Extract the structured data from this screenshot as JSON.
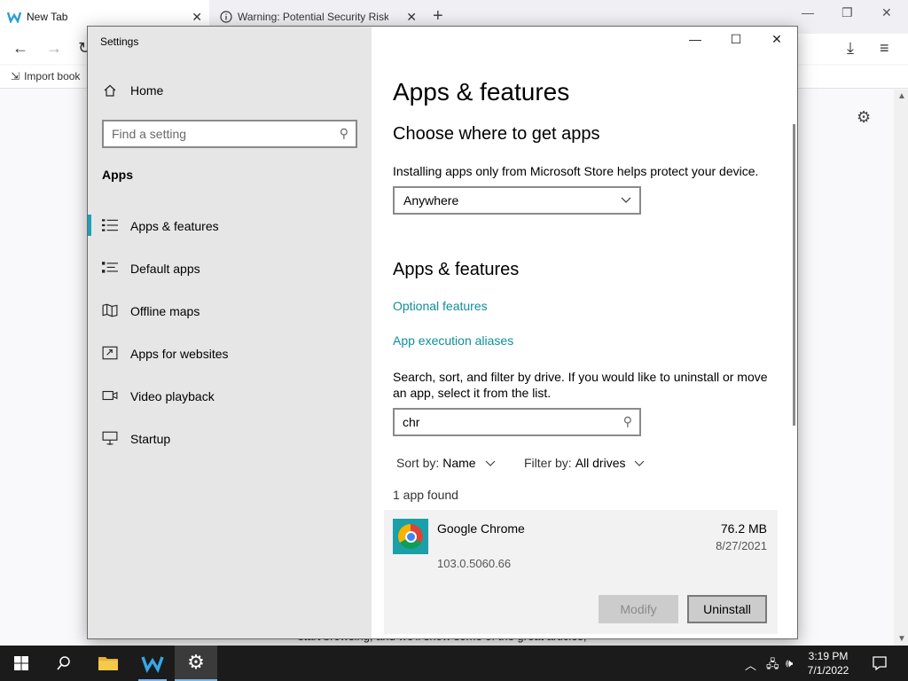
{
  "browser": {
    "tabs": [
      {
        "title": "New Tab",
        "active": true
      },
      {
        "title": "Warning: Potential Security Risk Ah",
        "active": false
      }
    ],
    "bookmark": "Import book",
    "bottom_text": "start browsing, and we'll show some of the great articles,"
  },
  "settings": {
    "window_title": "Settings",
    "home_label": "Home",
    "search": {
      "placeholder": "Find a setting"
    },
    "section_label": "Apps",
    "nav": [
      {
        "label": "Apps & features",
        "icon": "list-icon",
        "active": true
      },
      {
        "label": "Default apps",
        "icon": "default-apps-icon",
        "active": false
      },
      {
        "label": "Offline maps",
        "icon": "map-icon",
        "active": false
      },
      {
        "label": "Apps for websites",
        "icon": "link-window-icon",
        "active": false
      },
      {
        "label": "Video playback",
        "icon": "video-icon",
        "active": false
      },
      {
        "label": "Startup",
        "icon": "startup-icon",
        "active": false
      }
    ],
    "main": {
      "title": "Apps & features",
      "choose_heading": "Choose where to get apps",
      "choose_desc": "Installing apps only from Microsoft Store helps protect your device.",
      "source_value": "Anywhere",
      "features_heading": "Apps & features",
      "optional_features": "Optional features",
      "execution_aliases": "App execution aliases",
      "search_desc": "Search, sort, and filter by drive. If you would like to uninstall or move an app, select it from the list.",
      "search_value": "chr",
      "sort_label": "Sort by:",
      "sort_value": "Name",
      "filter_label": "Filter by:",
      "filter_value": "All drives",
      "count_text": "1 app found",
      "app": {
        "name": "Google Chrome",
        "size": "76.2 MB",
        "date": "8/27/2021",
        "version": "103.0.5060.66"
      },
      "modify_label": "Modify",
      "uninstall_label": "Uninstall"
    }
  },
  "taskbar": {
    "time": "3:19 PM",
    "date": "7/1/2022"
  },
  "colors": {
    "accent": "#1aa0b8",
    "link": "#0e8f9c",
    "taskbar": "#1b1b1b"
  }
}
